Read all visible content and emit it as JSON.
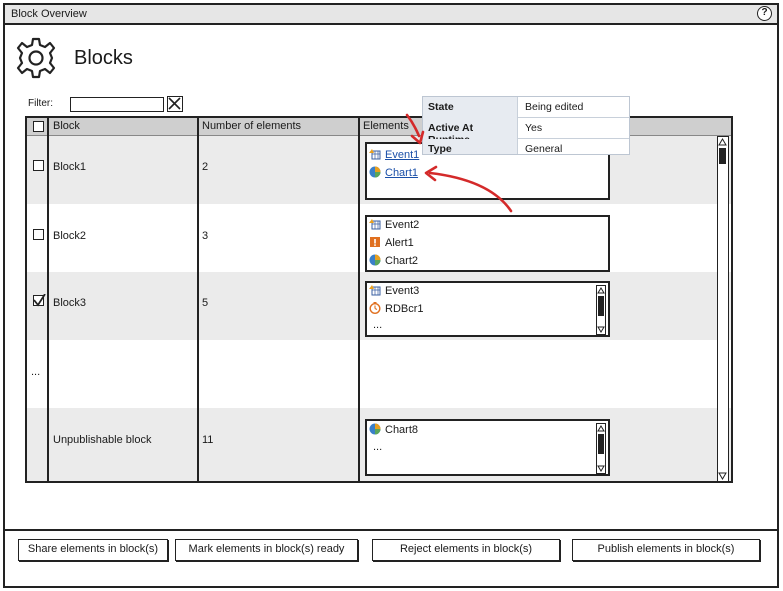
{
  "window": {
    "title": "Block Overview",
    "help_icon": "?"
  },
  "page": {
    "title": "Blocks",
    "icon": "gear-icon"
  },
  "filter": {
    "label": "Filter:",
    "value": "",
    "clear_icon": "x-box-icon"
  },
  "table": {
    "columns": [
      "Block",
      "Number of elements",
      "Elements"
    ],
    "rows": [
      {
        "checked": false,
        "block": "Block1",
        "count": "2",
        "elements": [
          {
            "icon": "event-icon",
            "name": "Event1",
            "link": true
          },
          {
            "icon": "chart-icon",
            "name": "Chart1",
            "link": true
          }
        ]
      },
      {
        "checked": false,
        "block": "Block2",
        "count": "3",
        "elements": [
          {
            "icon": "event-icon",
            "name": "Event2"
          },
          {
            "icon": "alert-icon",
            "name": "Alert1"
          },
          {
            "icon": "chart-icon",
            "name": "Chart2"
          }
        ]
      },
      {
        "checked": true,
        "block": "Block3",
        "count": "5",
        "elements": [
          {
            "icon": "event-icon",
            "name": "Event3"
          },
          {
            "icon": "timer-icon",
            "name": "RDBcr1"
          },
          {
            "name": "..."
          }
        ]
      },
      {
        "ellipsis": "..."
      },
      {
        "block": "Unpublishable block",
        "count": "11",
        "elements": [
          {
            "icon": "chart-icon",
            "name": "Chart8"
          },
          {
            "name": "..."
          }
        ]
      }
    ]
  },
  "popup": {
    "rows": [
      {
        "key": "State",
        "value": "Being edited"
      },
      {
        "key": "Active At Runtime",
        "value": "Yes"
      },
      {
        "key": "Type",
        "value": "General"
      }
    ]
  },
  "buttons": {
    "share": "Share elements in block(s)",
    "mark_ready": "Mark elements in block(s) ready",
    "reject": "Reject elements in block(s)",
    "publish": "Publish elements in block(s)"
  },
  "colors": {
    "header_bg": "#cfcfcf",
    "row_shade": "#ebebeb",
    "link": "#1a4fa8",
    "arrow": "#d42a2a",
    "popup_key_bg": "#e7ebf1"
  }
}
